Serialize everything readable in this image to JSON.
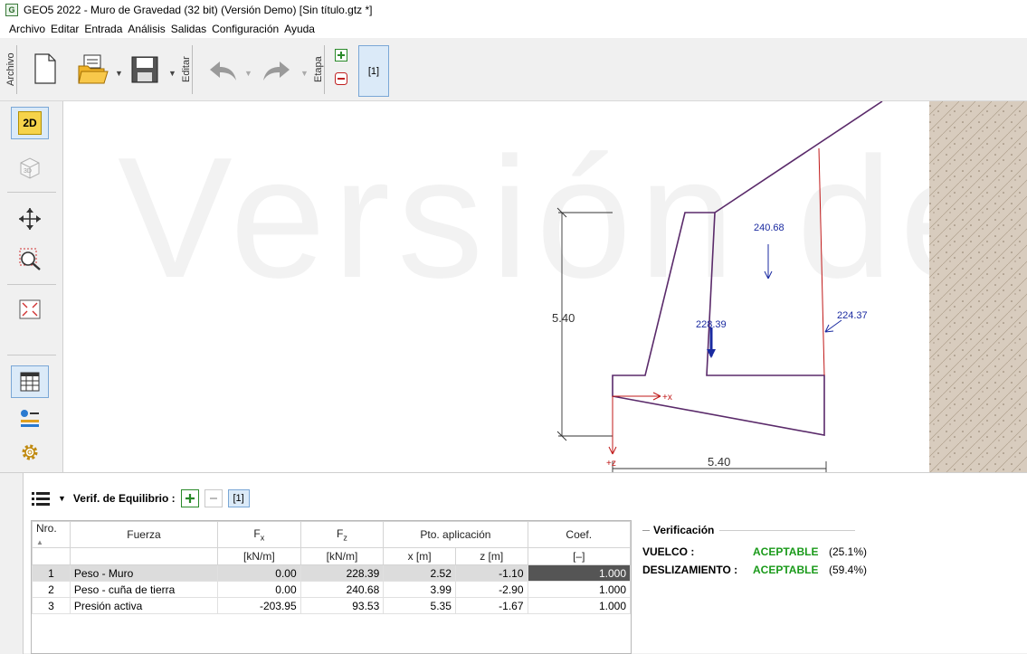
{
  "window": {
    "title": "GEO5 2022 - Muro de Gravedad (32 bit) (Versión Demo) [Sin título.gtz *]"
  },
  "menu": [
    "Archivo",
    "Editar",
    "Entrada",
    "Análisis",
    "Salidas",
    "Configuración",
    "Ayuda"
  ],
  "toolbar": {
    "group_archivo": "Archivo",
    "group_editar": "Editar",
    "group_etapa": "Etapa",
    "stage": "[1]"
  },
  "leftbar": {
    "btn_2d": "2D",
    "btn_3d": "3D"
  },
  "canvas": {
    "watermark": "Versión de",
    "dim_height": "5.40",
    "dim_width": "5.40",
    "force_wedge": "240.68",
    "force_wall": "228.39",
    "force_active": "224.37",
    "axis_x": "+x",
    "axis_z": "+z"
  },
  "bottom": {
    "title": "Verif. de Equilibrio :",
    "stage": "[1]",
    "table": {
      "headers": {
        "nro": "Nro.",
        "fuerza": "Fuerza",
        "fx": "Fx",
        "fz": "Fz",
        "pto": "Pto. aplicación",
        "coef": "Coef.",
        "fx_unit": "[kN/m]",
        "fz_unit": "[kN/m]",
        "x_unit": "x [m]",
        "z_unit": "z [m]",
        "coef_unit": "[–]"
      },
      "rows": [
        {
          "nro": "1",
          "fuerza": "Peso - Muro",
          "fx": "0.00",
          "fz": "228.39",
          "x": "2.52",
          "z": "-1.10",
          "coef": "1.000"
        },
        {
          "nro": "2",
          "fuerza": "Peso - cuña de tierra",
          "fx": "0.00",
          "fz": "240.68",
          "x": "3.99",
          "z": "-2.90",
          "coef": "1.000"
        },
        {
          "nro": "3",
          "fuerza": "Presión activa",
          "fx": "-203.95",
          "fz": "93.53",
          "x": "5.35",
          "z": "-1.67",
          "coef": "1.000"
        }
      ]
    },
    "verification": {
      "title": "Verificación",
      "vuelco_label": "VUELCO :",
      "vuelco_status": "ACEPTABLE",
      "vuelco_pct": "(25.1%)",
      "desl_label": "DESLIZAMIENTO :",
      "desl_status": "ACEPTABLE",
      "desl_pct": "(59.4%)"
    }
  },
  "colors": {
    "accept": "#1a9a1a",
    "wall": "#5a2a6a",
    "force": "#1a2aa0",
    "active": "#c01818"
  }
}
